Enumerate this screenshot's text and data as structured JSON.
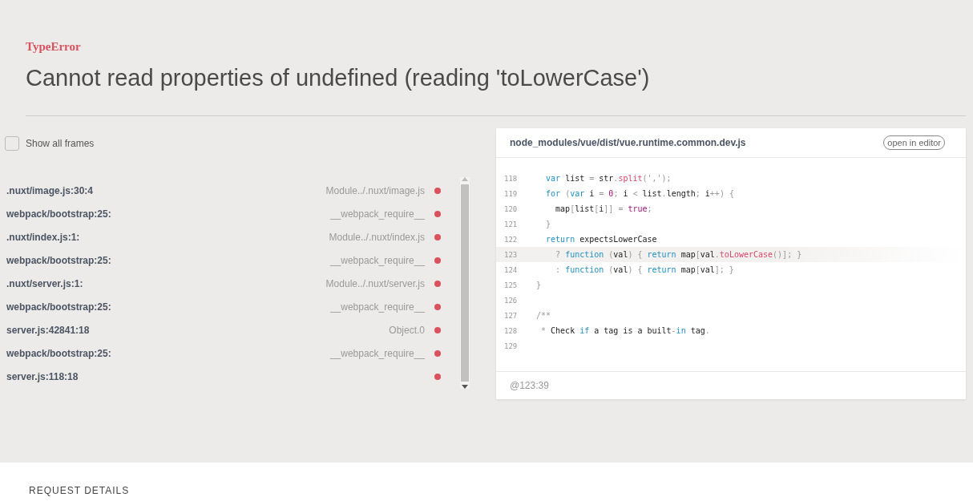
{
  "error": {
    "type": "TypeError",
    "message": "Cannot read properties of undefined (reading 'toLowerCase')"
  },
  "frames_toggle": {
    "label": "Show all frames",
    "checked": false
  },
  "frames": [
    {
      "file": ".nuxt/image.js:30:4",
      "function": "Module../.nuxt/image.js"
    },
    {
      "file": "webpack/bootstrap:25:",
      "function": "__webpack_require__"
    },
    {
      "file": ".nuxt/index.js:1:",
      "function": "Module../.nuxt/index.js"
    },
    {
      "file": "webpack/bootstrap:25:",
      "function": "__webpack_require__"
    },
    {
      "file": ".nuxt/server.js:1:",
      "function": "Module../.nuxt/server.js"
    },
    {
      "file": "webpack/bootstrap:25:",
      "function": "__webpack_require__"
    },
    {
      "file": "server.js:42841:18",
      "function": "Object.0"
    },
    {
      "file": "webpack/bootstrap:25:",
      "function": "__webpack_require__"
    },
    {
      "file": "server.js:118:18"
    }
  ],
  "code_panel": {
    "path": "node_modules/vue/dist/vue.runtime.common.dev.js",
    "open_button": "open in editor",
    "position": "@123:39",
    "lines": [
      {
        "number": "118",
        "highlighted": false,
        "tokens": [
          {
            "kind": "kw",
            "text": "  var "
          },
          {
            "kind": "id",
            "text": "list "
          },
          {
            "kind": "punct",
            "text": "= "
          },
          {
            "kind": "id",
            "text": "str"
          },
          {
            "kind": "punct",
            "text": "."
          },
          {
            "kind": "fn",
            "text": "split"
          },
          {
            "kind": "punct",
            "text": "(',');"
          }
        ]
      },
      {
        "number": "119",
        "highlighted": false,
        "tokens": [
          {
            "kind": "kw",
            "text": "  for "
          },
          {
            "kind": "punct",
            "text": "("
          },
          {
            "kind": "kw",
            "text": "var "
          },
          {
            "kind": "id",
            "text": "i "
          },
          {
            "kind": "punct",
            "text": "= "
          },
          {
            "kind": "num",
            "text": "0"
          },
          {
            "kind": "punct",
            "text": "; "
          },
          {
            "kind": "id",
            "text": "i "
          },
          {
            "kind": "punct",
            "text": "< "
          },
          {
            "kind": "id",
            "text": "list"
          },
          {
            "kind": "punct",
            "text": "."
          },
          {
            "kind": "id",
            "text": "length"
          },
          {
            "kind": "punct",
            "text": "; "
          },
          {
            "kind": "id",
            "text": "i"
          },
          {
            "kind": "punct",
            "text": "++) {"
          }
        ]
      },
      {
        "number": "120",
        "highlighted": false,
        "tokens": [
          {
            "kind": "id",
            "text": "    map"
          },
          {
            "kind": "punct",
            "text": "["
          },
          {
            "kind": "id",
            "text": "list"
          },
          {
            "kind": "punct",
            "text": "["
          },
          {
            "kind": "id",
            "text": "i"
          },
          {
            "kind": "punct",
            "text": "]] = "
          },
          {
            "kind": "num",
            "text": "true"
          },
          {
            "kind": "punct",
            "text": ";"
          }
        ]
      },
      {
        "number": "121",
        "highlighted": false,
        "tokens": [
          {
            "kind": "punct",
            "text": "  }"
          }
        ]
      },
      {
        "number": "122",
        "highlighted": false,
        "tokens": [
          {
            "kind": "kw",
            "text": "  return "
          },
          {
            "kind": "id",
            "text": "expectsLowerCase"
          }
        ]
      },
      {
        "number": "123",
        "highlighted": true,
        "tokens": [
          {
            "kind": "punct",
            "text": "    ? "
          },
          {
            "kind": "kw",
            "text": "function "
          },
          {
            "kind": "punct",
            "text": "("
          },
          {
            "kind": "id",
            "text": "val"
          },
          {
            "kind": "punct",
            "text": ") { "
          },
          {
            "kind": "kw",
            "text": "return "
          },
          {
            "kind": "id",
            "text": "map"
          },
          {
            "kind": "punct",
            "text": "["
          },
          {
            "kind": "id",
            "text": "val"
          },
          {
            "kind": "punct",
            "text": "."
          },
          {
            "kind": "fn",
            "text": "toLowerCase"
          },
          {
            "kind": "punct",
            "text": "()]; }"
          }
        ]
      },
      {
        "number": "124",
        "highlighted": false,
        "tokens": [
          {
            "kind": "punct",
            "text": "    : "
          },
          {
            "kind": "kw",
            "text": "function "
          },
          {
            "kind": "punct",
            "text": "("
          },
          {
            "kind": "id",
            "text": "val"
          },
          {
            "kind": "punct",
            "text": ") { "
          },
          {
            "kind": "kw",
            "text": "return "
          },
          {
            "kind": "id",
            "text": "map"
          },
          {
            "kind": "punct",
            "text": "["
          },
          {
            "kind": "id",
            "text": "val"
          },
          {
            "kind": "punct",
            "text": "]; }"
          }
        ]
      },
      {
        "number": "125",
        "highlighted": false,
        "tokens": [
          {
            "kind": "punct",
            "text": "}"
          }
        ]
      },
      {
        "number": "126",
        "highlighted": false
      },
      {
        "number": "127",
        "highlighted": false,
        "tokens": [
          {
            "kind": "comment",
            "text": "/**"
          }
        ]
      },
      {
        "number": "128",
        "highlighted": false,
        "tokens": [
          {
            "kind": "comment",
            "text": " * "
          },
          {
            "kind": "id",
            "text": "Check "
          },
          {
            "kind": "kw",
            "text": "if "
          },
          {
            "kind": "id",
            "text": "a tag is a built"
          },
          {
            "kind": "punct",
            "text": "-"
          },
          {
            "kind": "kw",
            "text": "in "
          },
          {
            "kind": "id",
            "text": "tag"
          },
          {
            "kind": "punct",
            "text": "."
          }
        ]
      },
      {
        "number": "129",
        "highlighted": false
      }
    ]
  },
  "request_details": {
    "heading": "REQUEST DETAILS"
  }
}
